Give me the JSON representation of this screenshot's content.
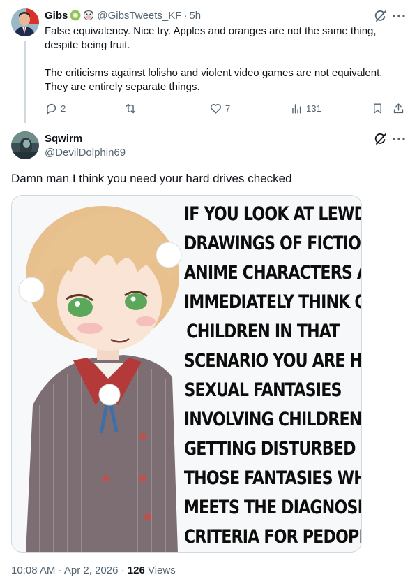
{
  "parent_tweet": {
    "display_name": "Gibs",
    "handle": "@GibsTweets_KF",
    "separator": "·",
    "time": "5h",
    "paragraphs": [
      "False equivalency. Nice try. Apples and oranges are not the same thing,",
      "despite being fruit.",
      "The criticisms against lolisho and violent video games are not equivalent.",
      "They are entirely separate things."
    ],
    "actions": {
      "replies": "2",
      "reposts": "",
      "likes": "7",
      "views": "131"
    },
    "icons": [
      "grok-icon",
      "more-icon",
      "reply-icon",
      "repost-icon",
      "like-icon",
      "views-icon",
      "bookmark-icon",
      "share-icon"
    ]
  },
  "reply_tweet": {
    "display_name": "Sqwirm",
    "handle": "@DevilDolphin69",
    "text": "Damn man I think you need your hard drives checked",
    "meme_lines": [
      "IF YOU LOOK AT LEWD",
      "DRAWINGS OF FICTIONAL",
      "ANIME CHARACTERS AND",
      "IMMEDIATELY THINK OF",
      "CHILDREN IN THAT",
      "SCENARIO YOU ARE HAVING",
      "SEXUAL FANTASIES",
      "INVOLVING CHILDREN THEN",
      "GETTING DISTURBED BY",
      "THOSE FANTASIES WHICH",
      "MEETS THE DIAGNOSIS",
      "CRITERIA FOR PEDOPHILIA"
    ],
    "timestamp": "10:08 AM · Apr 2, 2026 · ",
    "views_count": "126",
    "views_label": " Views"
  },
  "colors": {
    "text_primary": "#0f1419",
    "text_secondary": "#536471",
    "border": "#cfd9de"
  }
}
